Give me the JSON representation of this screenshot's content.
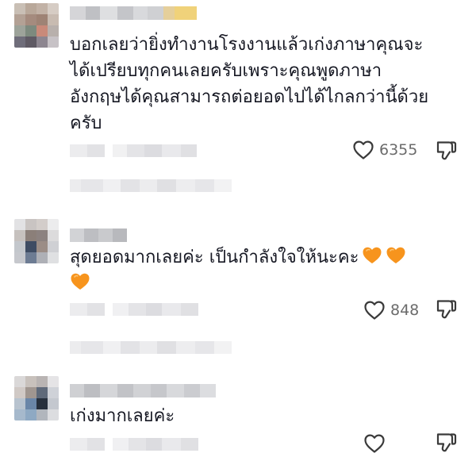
{
  "comments": [
    {
      "text_lines": [
        "บอกเลยว่ายิ่งทำงานโรงงานแล้วเก่งภาษาคุณจะ",
        "ได้เปรียบทุกคนเลยครับเพราะคุณพูดภาษา",
        "อังกฤษได้คุณสามารถต่อยอดไปได้ไกลกว่านี้ด้วย",
        "ครับ"
      ],
      "like_count": "6355"
    },
    {
      "text": "สุดยอดมากเลยค่ะ เป็นกำลังใจให้นะคะ",
      "emoji_count": 3,
      "like_count": "848"
    },
    {
      "text": "เก่งมากเลยค่ะ",
      "like_count": ""
    }
  ],
  "icons": {
    "like": "heart-outline-icon",
    "dislike": "thumbs-down-outline-icon",
    "emoji": "orange-heart-emoji"
  },
  "colors": {
    "text": "#161823",
    "count": "#6b6b6b",
    "icon": "#3a3a3a",
    "emoji": "#F7941D"
  }
}
